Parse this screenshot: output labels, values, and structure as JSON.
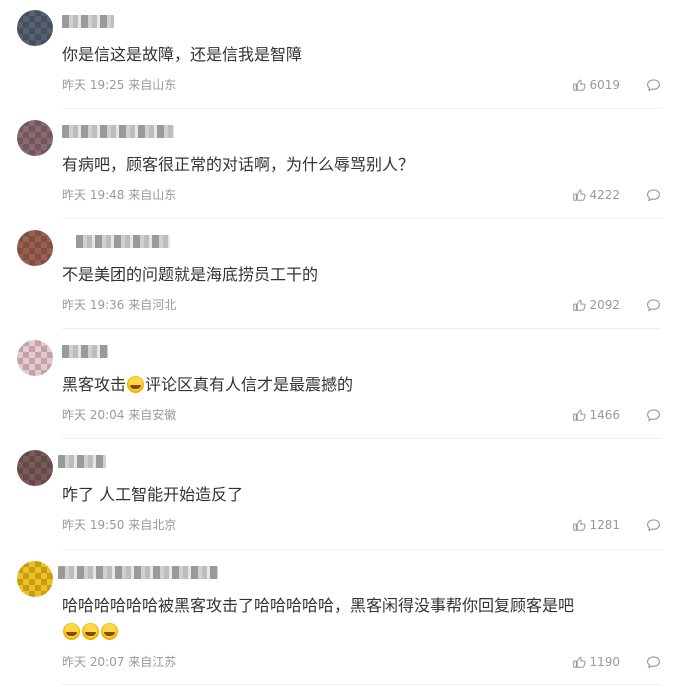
{
  "comments": [
    {
      "user": "用户",
      "text": "你是信这是故障，还是信我是智障",
      "date": "昨天",
      "time": "19:25",
      "location": "来自山东",
      "likes": "6019"
    },
    {
      "user": "用户",
      "text": "有病吧，顾客很正常的对话啊，为什么辱骂别人？",
      "date": "昨天",
      "time": "19:48",
      "location": "来自山东",
      "likes": "4222"
    },
    {
      "user": "用户",
      "text": "不是美团的问题就是海底捞员工干的",
      "date": "昨天",
      "time": "19:36",
      "location": "来自河北",
      "likes": "2092"
    },
    {
      "user": "用户",
      "text_a": "黑客攻击",
      "text_b": "评论区真有人信才是最震撼的",
      "date": "昨天",
      "time": "20:04",
      "location": "来自安徽",
      "likes": "1466",
      "emoji": "laugh-cry-emoji"
    },
    {
      "user": "用户",
      "text": "咋了 人工智能开始造反了",
      "date": "昨天",
      "time": "19:50",
      "location": "来自北京",
      "likes": "1281"
    },
    {
      "user": "用户",
      "text": "哈哈哈哈哈哈被黑客攻击了哈哈哈哈哈，黑客闲得没事帮你回复顾客是吧",
      "date": "昨天",
      "time": "20:07",
      "location": "来自江苏",
      "likes": "1190",
      "emoji": "laugh-cry-emoji"
    }
  ],
  "colors": {
    "text": "#333333",
    "meta": "#999999",
    "divider": "#eeeeee",
    "emoji": "#ffd84a"
  },
  "icons": {
    "like": "thumbs-up-icon",
    "reply": "comment-bubble-icon"
  }
}
